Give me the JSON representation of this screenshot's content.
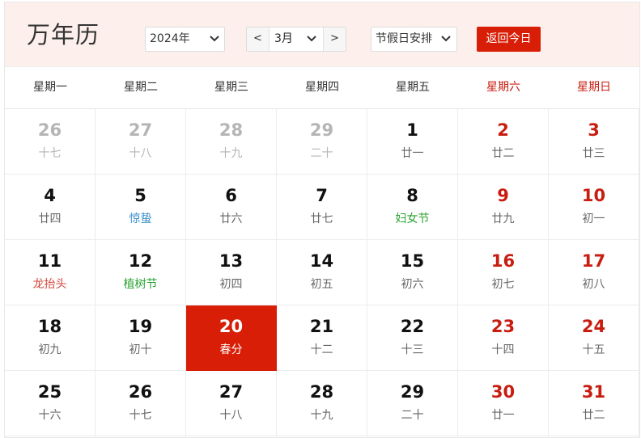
{
  "app": {
    "title": "万年历"
  },
  "controls": {
    "year": "2024年",
    "month_prev": "<",
    "month": "3月",
    "month_next": ">",
    "holiday": "节假日安排",
    "today_button": "返回今日"
  },
  "colors": {
    "accent": "#d81e06",
    "weekend": "#c81d11",
    "header_bg": "#fdf0ec"
  },
  "weekdays": [
    "星期一",
    "星期二",
    "星期三",
    "星期四",
    "星期五",
    "星期六",
    "星期日"
  ],
  "weeks": [
    [
      {
        "day": "26",
        "lunar": "十七",
        "other": true
      },
      {
        "day": "27",
        "lunar": "十八",
        "other": true
      },
      {
        "day": "28",
        "lunar": "十九",
        "other": true
      },
      {
        "day": "29",
        "lunar": "二十",
        "other": true
      },
      {
        "day": "1",
        "lunar": "廿一"
      },
      {
        "day": "2",
        "lunar": "廿二",
        "weekend": true
      },
      {
        "day": "3",
        "lunar": "廿三",
        "weekend": true
      }
    ],
    [
      {
        "day": "4",
        "lunar": "廿四"
      },
      {
        "day": "5",
        "lunar": "惊蛰",
        "festival": "blue"
      },
      {
        "day": "6",
        "lunar": "廿六"
      },
      {
        "day": "7",
        "lunar": "廿七"
      },
      {
        "day": "8",
        "lunar": "妇女节",
        "festival": "green"
      },
      {
        "day": "9",
        "lunar": "廿九",
        "weekend": true
      },
      {
        "day": "10",
        "lunar": "初一",
        "weekend": true
      }
    ],
    [
      {
        "day": "11",
        "lunar": "龙抬头",
        "festival": "red"
      },
      {
        "day": "12",
        "lunar": "植树节",
        "festival": "green"
      },
      {
        "day": "13",
        "lunar": "初四"
      },
      {
        "day": "14",
        "lunar": "初五"
      },
      {
        "day": "15",
        "lunar": "初六"
      },
      {
        "day": "16",
        "lunar": "初七",
        "weekend": true
      },
      {
        "day": "17",
        "lunar": "初八",
        "weekend": true
      }
    ],
    [
      {
        "day": "18",
        "lunar": "初九"
      },
      {
        "day": "19",
        "lunar": "初十"
      },
      {
        "day": "20",
        "lunar": "春分",
        "today": true
      },
      {
        "day": "21",
        "lunar": "十二"
      },
      {
        "day": "22",
        "lunar": "十三"
      },
      {
        "day": "23",
        "lunar": "十四",
        "weekend": true
      },
      {
        "day": "24",
        "lunar": "十五",
        "weekend": true
      }
    ],
    [
      {
        "day": "25",
        "lunar": "十六"
      },
      {
        "day": "26",
        "lunar": "十七"
      },
      {
        "day": "27",
        "lunar": "十八"
      },
      {
        "day": "28",
        "lunar": "十九"
      },
      {
        "day": "29",
        "lunar": "二十"
      },
      {
        "day": "30",
        "lunar": "廿一",
        "weekend": true
      },
      {
        "day": "31",
        "lunar": "廿二",
        "weekend": true
      }
    ]
  ]
}
